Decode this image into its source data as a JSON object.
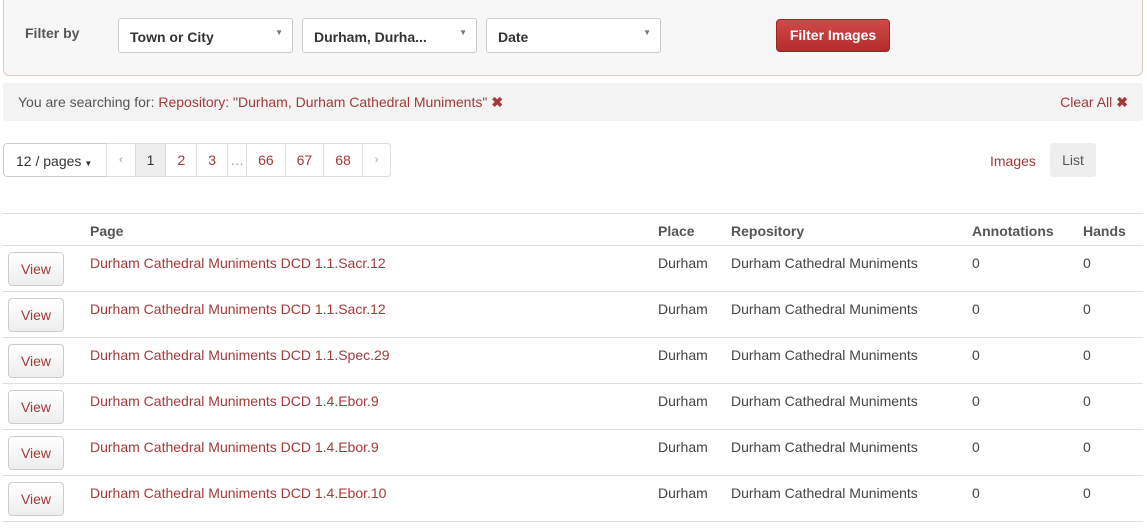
{
  "filter": {
    "label": "Filter by",
    "selects": [
      "Town or City",
      "Durham, Durha...",
      "Date"
    ],
    "button_label": "Filter Images"
  },
  "search": {
    "prefix": "You are searching for:",
    "term": "Repository: \"Durham, Durham Cathedral Muniments\"",
    "remove_icon": "✖",
    "clear_all": "Clear All"
  },
  "pagination": {
    "per_page": "12 / pages",
    "prev": "‹",
    "next": "›",
    "pages": [
      "1",
      "2",
      "3",
      "…",
      "66",
      "67",
      "68"
    ],
    "current": "1"
  },
  "view_toggle": {
    "images": "Images",
    "list": "List",
    "active": "List"
  },
  "table": {
    "headers": [
      "",
      "Page",
      "Place",
      "Repository",
      "Annotations",
      "Hands"
    ],
    "view_label": "View",
    "rows": [
      {
        "page": "Durham Cathedral Muniments DCD 1.1.Sacr.12",
        "place": "Durham",
        "repository": "Durham Cathedral Muniments",
        "annotations": "0",
        "hands": "0"
      },
      {
        "page": "Durham Cathedral Muniments DCD 1.1.Sacr.12",
        "place": "Durham",
        "repository": "Durham Cathedral Muniments",
        "annotations": "0",
        "hands": "0"
      },
      {
        "page": "Durham Cathedral Muniments DCD 1.1.Spec.29",
        "place": "Durham",
        "repository": "Durham Cathedral Muniments",
        "annotations": "0",
        "hands": "0"
      },
      {
        "page": "Durham Cathedral Muniments DCD 1.4.Ebor.9",
        "place": "Durham",
        "repository": "Durham Cathedral Muniments",
        "annotations": "0",
        "hands": "0"
      },
      {
        "page": "Durham Cathedral Muniments DCD 1.4.Ebor.9",
        "place": "Durham",
        "repository": "Durham Cathedral Muniments",
        "annotations": "0",
        "hands": "0"
      },
      {
        "page": "Durham Cathedral Muniments DCD 1.4.Ebor.10",
        "place": "Durham",
        "repository": "Durham Cathedral Muniments",
        "annotations": "0",
        "hands": "0"
      }
    ]
  },
  "colors": {
    "accent": "#a33a3a",
    "button": "#c03a3a"
  }
}
